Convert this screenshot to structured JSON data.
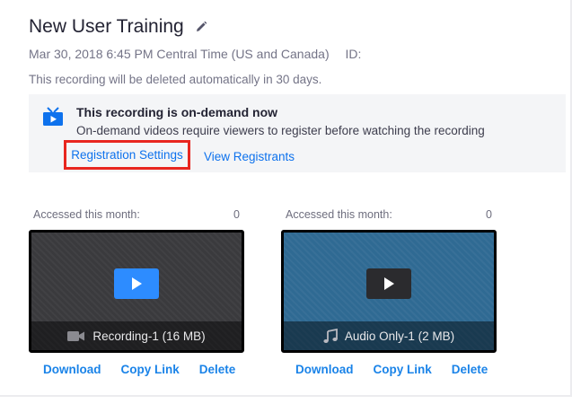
{
  "recording": {
    "title": "New User Training",
    "datetime": "Mar 30, 2018 6:45 PM Central Time (US and Canada)",
    "id_label": "ID:",
    "retention_note": "This recording will be deleted automatically in 30 days."
  },
  "on_demand": {
    "title": "This recording is on-demand now",
    "description": "On-demand videos require viewers to register before watching the recording",
    "registration_settings": "Registration Settings",
    "view_registrants": "View Registrants",
    "highlight_color": "#e8261f"
  },
  "files": [
    {
      "accessed_label": "Accessed this month:",
      "accessed_count": "0",
      "name": "Recording-1 (16 MB)",
      "type_icon": "video-camera-icon",
      "download": "Download",
      "copy_link": "Copy Link",
      "delete": "Delete"
    },
    {
      "accessed_label": "Accessed this month:",
      "accessed_count": "0",
      "name": "Audio Only-1 (2 MB)",
      "type_icon": "music-note-icon",
      "download": "Download",
      "copy_link": "Copy Link",
      "delete": "Delete"
    }
  ],
  "colors": {
    "link": "#0e72ed",
    "play_button_video": "#2d8cff",
    "audio_thumbnail": "#2f6a93"
  }
}
